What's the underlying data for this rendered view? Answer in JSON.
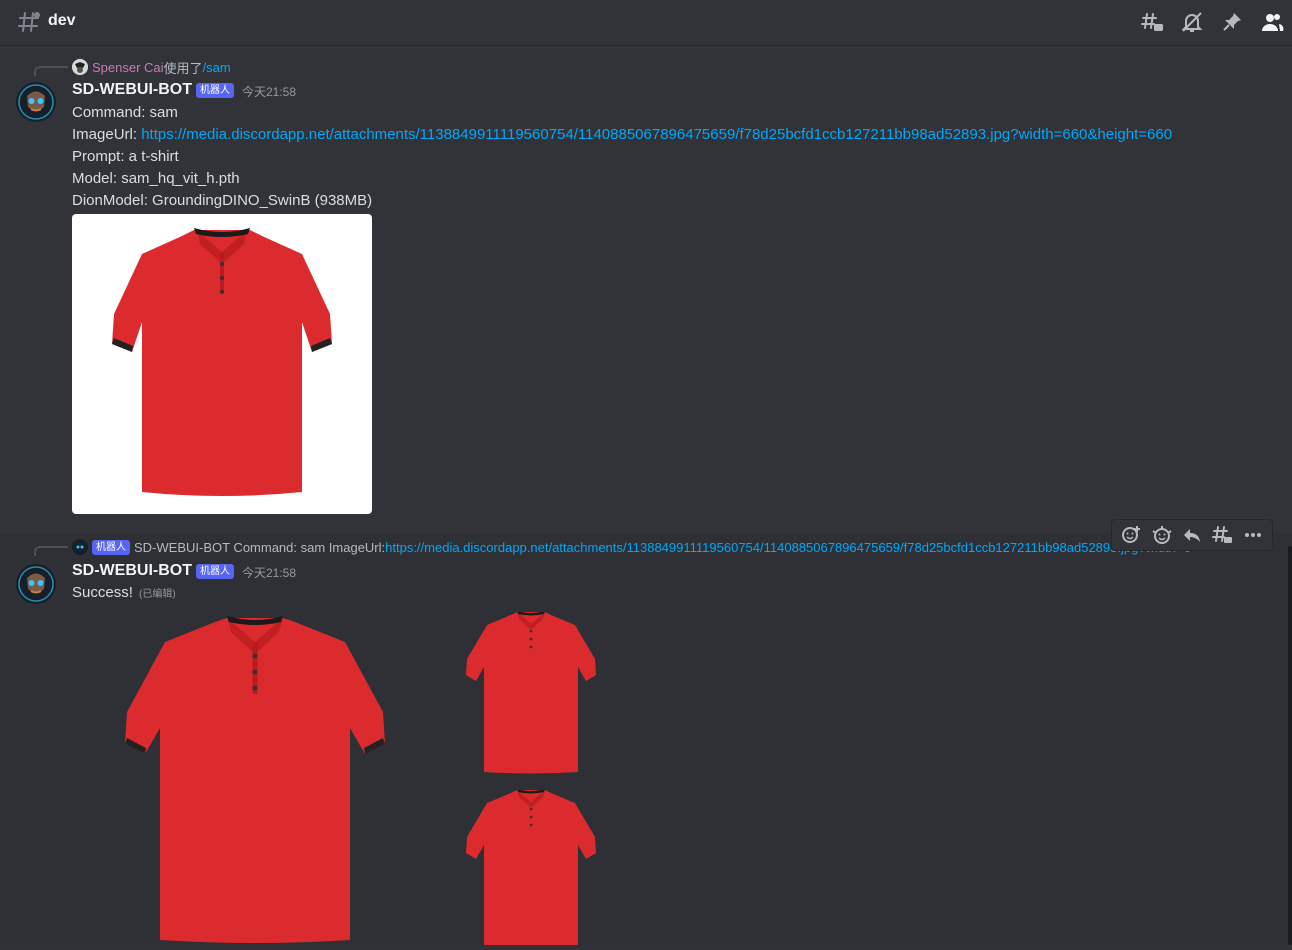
{
  "header": {
    "channel_name": "dev",
    "icons": [
      "threads-icon",
      "notifications-muted-icon",
      "pin-icon",
      "member-list-icon"
    ]
  },
  "message1": {
    "reply_user": "Spenser Cai",
    "reply_used": "使用了",
    "reply_command": "/sam",
    "username": "SD-WEBUI-BOT",
    "bot_tag": "机器人",
    "timestamp": "今天21:58",
    "line_command": "Command: sam",
    "imageurl_label": "ImageUrl: ",
    "imageurl": "https://media.discordapp.net/attachments/1138849911119560754/1140885067896475659/f78d25bcfd1ccb127211bb98ad52893.jpg?width=660&height=660",
    "line_prompt": "Prompt: a t-shirt",
    "line_model": "Model: sam_hq_vit_h.pth",
    "line_dion": "DionModel: GroundingDINO_SwinB (938MB)"
  },
  "message2": {
    "reply_bot_tag": "机器人",
    "reply_text": "SD-WEBUI-BOT Command: sam ImageUrl: ",
    "reply_link": "https://media.discordapp.net/attachments/1138849911119560754/1140885067896475659/f78d25bcfd1ccb127211bb98ad52893.jpg?width=6",
    "username": "SD-WEBUI-BOT",
    "bot_tag": "机器人",
    "timestamp": "今天21:58",
    "content": "Success!",
    "edited": "(已编辑)"
  },
  "toolbar": {
    "icons": [
      "add-reaction-icon",
      "super-reaction-icon",
      "reply-icon",
      "create-thread-icon",
      "more-icon"
    ]
  },
  "colors": {
    "background": "#313338",
    "link": "#00a8fc",
    "bot_tag": "#5865f2",
    "reply_user": "#c77dba",
    "shirt": "#dc2b2e"
  }
}
